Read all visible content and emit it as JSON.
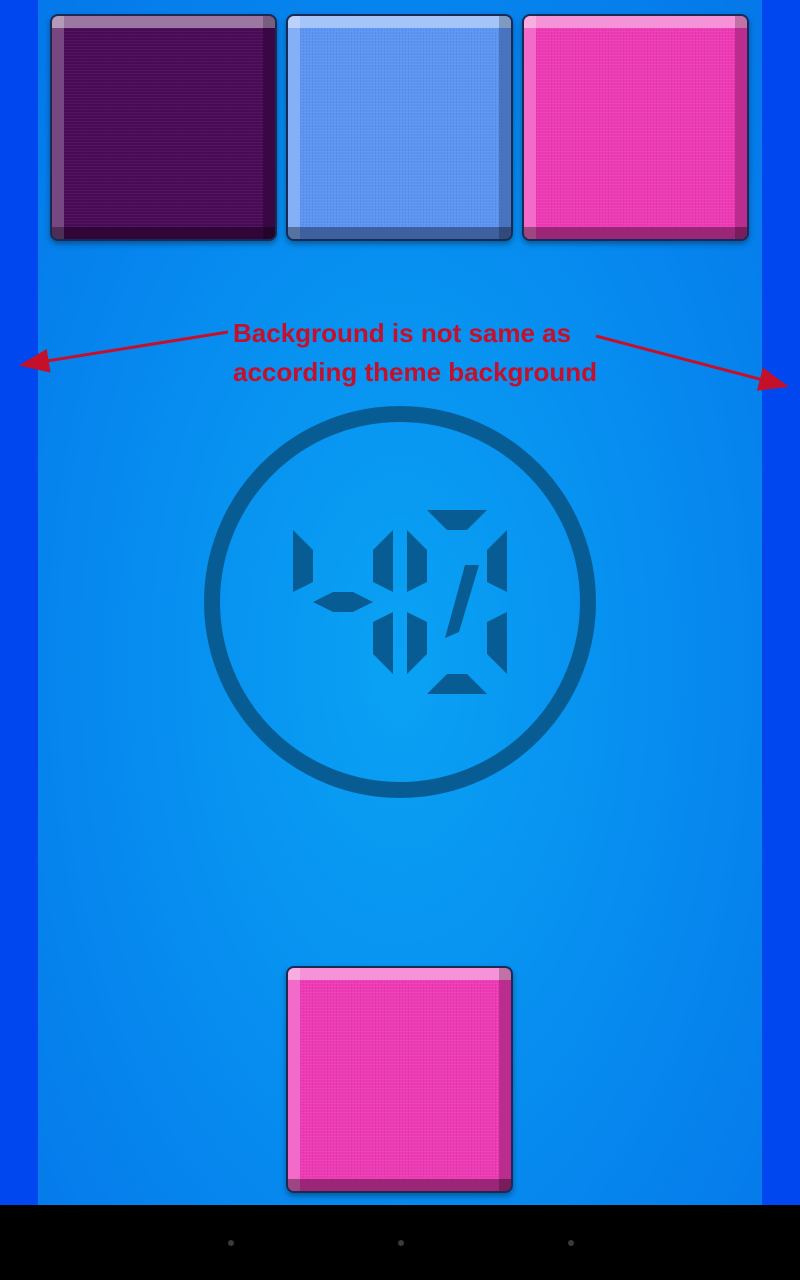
{
  "game": {
    "timer_value": "40",
    "top_tiles": [
      {
        "name": "tile-dark-purple",
        "color": "#4a0a57"
      },
      {
        "name": "tile-light-blue",
        "color": "#5c95f3"
      },
      {
        "name": "tile-pink",
        "color": "#ef3ab6"
      }
    ],
    "bottom_tile": {
      "name": "tile-pink-target",
      "color": "#ef3ab6"
    }
  },
  "annotation": {
    "line1": "Background is not same as",
    "line2": "according theme background",
    "color": "#c4102a"
  },
  "theme": {
    "outer_background": "#0046ee",
    "play_background": "#078ff0",
    "timer_color": "#075d93"
  },
  "navbar": {
    "dots": 3
  }
}
